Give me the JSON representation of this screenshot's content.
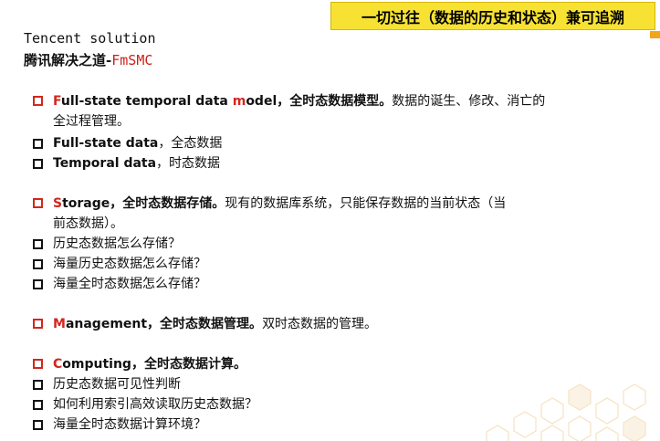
{
  "banner": "一切过往（数据的历史和状态）兼可追溯",
  "title_line1": "Tencent solution",
  "title_line2_cn": "腾讯解决之道-",
  "title_line2_red": "FmSMC",
  "sections": {
    "model": {
      "cap1": "F",
      "head1": "ull-state temporal data ",
      "cap2": "m",
      "head2": "odel，全时态数据模型。",
      "rest": "数据的诞生、修改、消亡的",
      "cont": "全过程管理。",
      "subs": [
        {
          "bold": "Full-state data",
          "text": "，全态数据"
        },
        {
          "bold": "Temporal data",
          "text": "，时态数据"
        }
      ]
    },
    "storage": {
      "cap": "S",
      "head": "torage，全时态数据存储。",
      "rest": "现有的数据库系统，只能保存数据的当前状态（当",
      "cont": "前态数据）。",
      "subs": [
        "历史态数据怎么存储？",
        "海量历史态数据怎么存储？",
        "海量全时态数据怎么存储？"
      ]
    },
    "management": {
      "cap": "M",
      "head": "anagement，全时态数据管理。",
      "rest": "双时态数据的管理。"
    },
    "computing": {
      "cap": "C",
      "head": "omputing，全时态数据计算。",
      "subs": [
        "历史态数据可见性判断",
        "如何利用索引高效读取历史态数据？",
        "海量全时态数据计算环境？"
      ]
    }
  },
  "colors": {
    "accent_red": "#d2271f",
    "banner_yellow": "#f7e233",
    "hex_orange": "#f2a51a"
  }
}
